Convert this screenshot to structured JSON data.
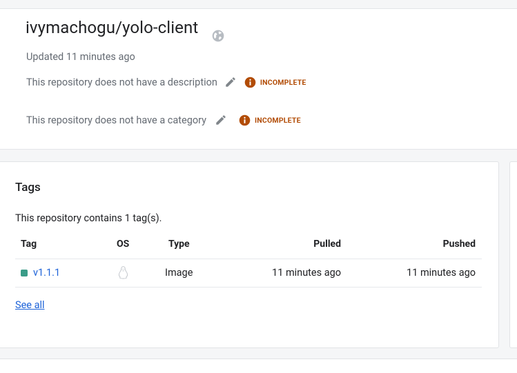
{
  "repo": {
    "title": "ivymachogu/yolo-client",
    "updated": "Updated 11 minutes ago",
    "visibility_icon": "globe-icon"
  },
  "description_row": {
    "text": "This repository does not have a description",
    "status": "INCOMPLETE"
  },
  "category_row": {
    "text": "This repository does not have a category",
    "status": "INCOMPLETE"
  },
  "colors": {
    "incomplete": "#b24c06",
    "link": "#1c62d8",
    "tag_status": "#3a9c88"
  },
  "tags": {
    "title": "Tags",
    "summary": "This repository contains 1 tag(s).",
    "columns": [
      "Tag",
      "OS",
      "Type",
      "Pulled",
      "Pushed"
    ],
    "rows": [
      {
        "tag": "v1.1.1",
        "os_icon": "linux-icon",
        "type": "Image",
        "pulled": "11 minutes ago",
        "pushed": "11 minutes ago"
      }
    ],
    "see_all": "See all"
  }
}
